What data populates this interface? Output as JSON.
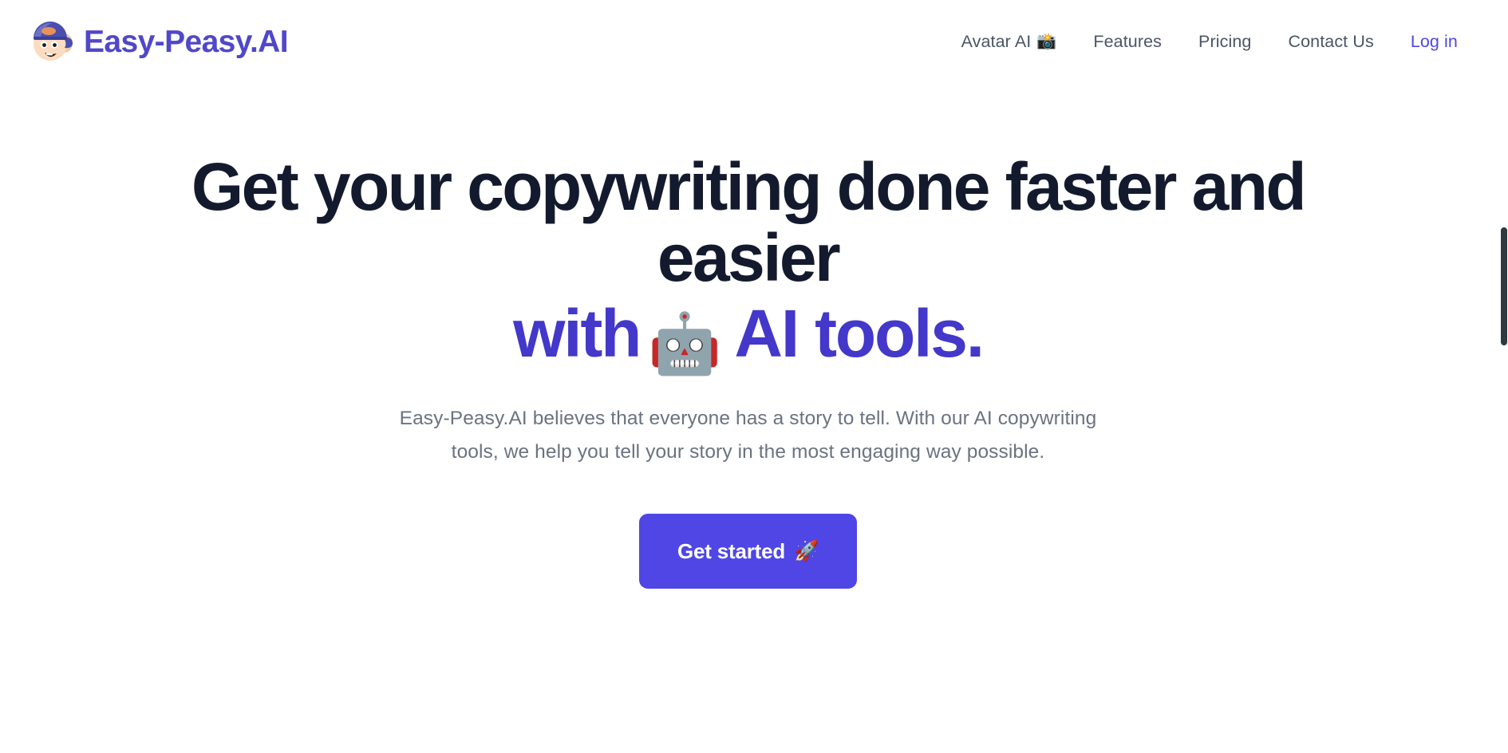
{
  "brand": {
    "name": "Easy-Peasy.AI",
    "logo_icon": "cartoon-face-with-cap-logo",
    "color": "#5048C8"
  },
  "nav": {
    "links": [
      {
        "label": "Avatar AI",
        "emoji": "📸",
        "emoji_name": "camera-with-flash-icon",
        "accent": false
      },
      {
        "label": "Features",
        "emoji": "",
        "emoji_name": "",
        "accent": false
      },
      {
        "label": "Pricing",
        "emoji": "",
        "emoji_name": "",
        "accent": false
      },
      {
        "label": "Contact Us",
        "emoji": "",
        "emoji_name": "",
        "accent": false
      },
      {
        "label": "Log in",
        "emoji": "",
        "emoji_name": "",
        "accent": true
      }
    ]
  },
  "hero": {
    "title_line_1": "Get your copywriting done faster and",
    "title_line_2": "easier",
    "accent_prefix": "with",
    "accent_emoji": "🤖",
    "accent_emoji_name": "robot-face-icon",
    "accent_suffix": "AI tools.",
    "subtitle": "Easy-Peasy.AI believes that everyone has a story to tell. With our AI copywriting tools, we help you tell your story in the most engaging way possible.",
    "cta_label": "Get started",
    "cta_emoji": "🚀",
    "cta_emoji_name": "rocket-icon",
    "title_color": "#141a2e",
    "accent_color": "#4338CA",
    "subtitle_color": "#6B7280",
    "cta_bg": "#4F46E5"
  },
  "scrollbar": {
    "thumb_color": "#2f3a40"
  }
}
